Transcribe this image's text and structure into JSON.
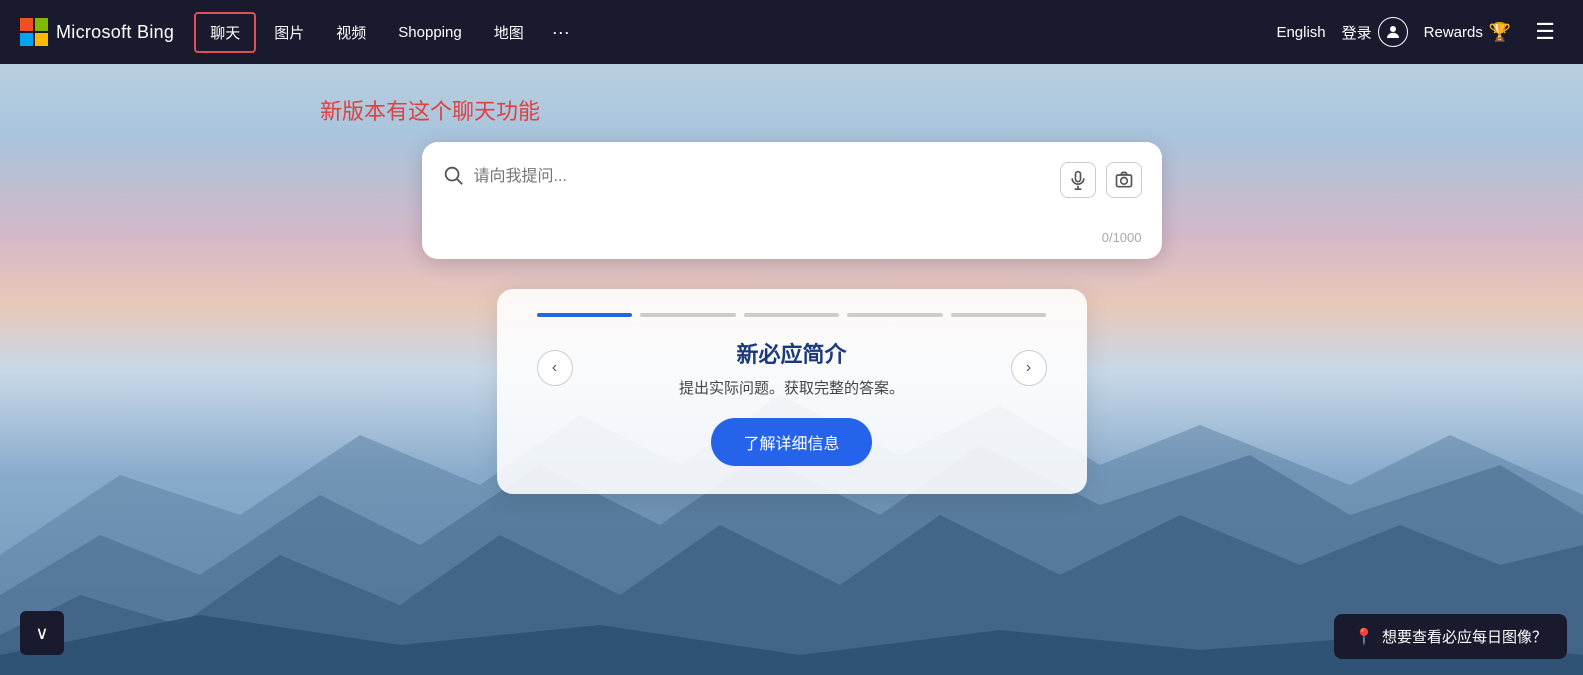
{
  "logo": {
    "brand": "Microsoft Bing"
  },
  "navbar": {
    "items": [
      {
        "label": "聊天",
        "active": true
      },
      {
        "label": "图片",
        "active": false
      },
      {
        "label": "视频",
        "active": false
      },
      {
        "label": "Shopping",
        "active": false
      },
      {
        "label": "地图",
        "active": false
      }
    ],
    "more_label": "···",
    "lang_label": "English",
    "login_label": "登录",
    "rewards_label": "Rewards",
    "menu_label": "☰"
  },
  "promo": {
    "text": "新版本有这个聊天功能"
  },
  "search": {
    "placeholder": "请向我提问...",
    "char_count": "0/1000"
  },
  "card": {
    "title": "新必应简介",
    "description": "提出实际问题。获取完整的答案。",
    "cta_label": "了解详细信息",
    "dots": [
      {
        "active": true
      },
      {
        "active": false
      },
      {
        "active": false
      },
      {
        "active": false
      },
      {
        "active": false
      }
    ]
  },
  "bottom_left": {
    "label": "∨"
  },
  "bottom_right": {
    "text": "想要查看必应每日图像？"
  }
}
